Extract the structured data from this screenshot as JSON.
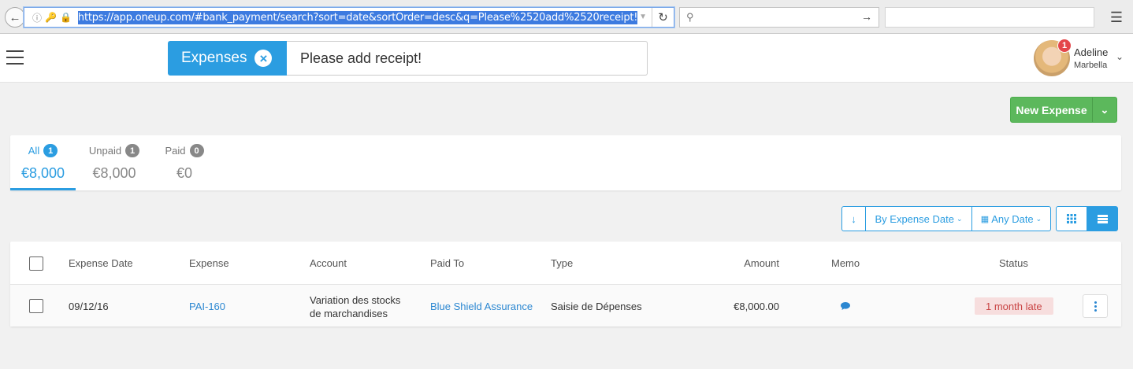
{
  "browser": {
    "url": "https://app.oneup.com/#bank_payment/search?sort=date&sortOrder=desc&q=Please%2520add%2520receipt!",
    "search_placeholder": ""
  },
  "header": {
    "search_tag": "Expenses",
    "search_query": "Please add receipt!",
    "user": {
      "first_name": "Adeline",
      "last_name": "Marbella",
      "notification_count": "1"
    }
  },
  "actions": {
    "new_expense": "New Expense"
  },
  "summary_tabs": [
    {
      "label": "All",
      "count": "1",
      "amount": "€8,000",
      "active": true
    },
    {
      "label": "Unpaid",
      "count": "1",
      "amount": "€8,000",
      "active": false
    },
    {
      "label": "Paid",
      "count": "0",
      "amount": "€0",
      "active": false
    }
  ],
  "toolbar": {
    "sort_direction_icon": "arrow-down",
    "sort_by": "By Expense Date",
    "date_filter": "Any Date",
    "view_modes": [
      "grid",
      "list"
    ],
    "selected_view": "list"
  },
  "table": {
    "columns": {
      "date": "Expense Date",
      "expense": "Expense",
      "account": "Account",
      "paid_to": "Paid To",
      "type": "Type",
      "amount": "Amount",
      "memo": "Memo",
      "status": "Status"
    },
    "rows": [
      {
        "date": "09/12/16",
        "expense": "PAI-160",
        "account_line1": "Variation des stocks",
        "account_line2": "de marchandises",
        "paid_to": "Blue Shield Assurance",
        "type": "Saisie de Dépenses",
        "amount": "€8,000.00",
        "memo_icon": "comment-icon",
        "status": "1 month late"
      }
    ]
  },
  "colors": {
    "accent": "#2b9de1",
    "success": "#5cb85c",
    "danger_bg": "#f7dede",
    "danger_text": "#c94444"
  }
}
